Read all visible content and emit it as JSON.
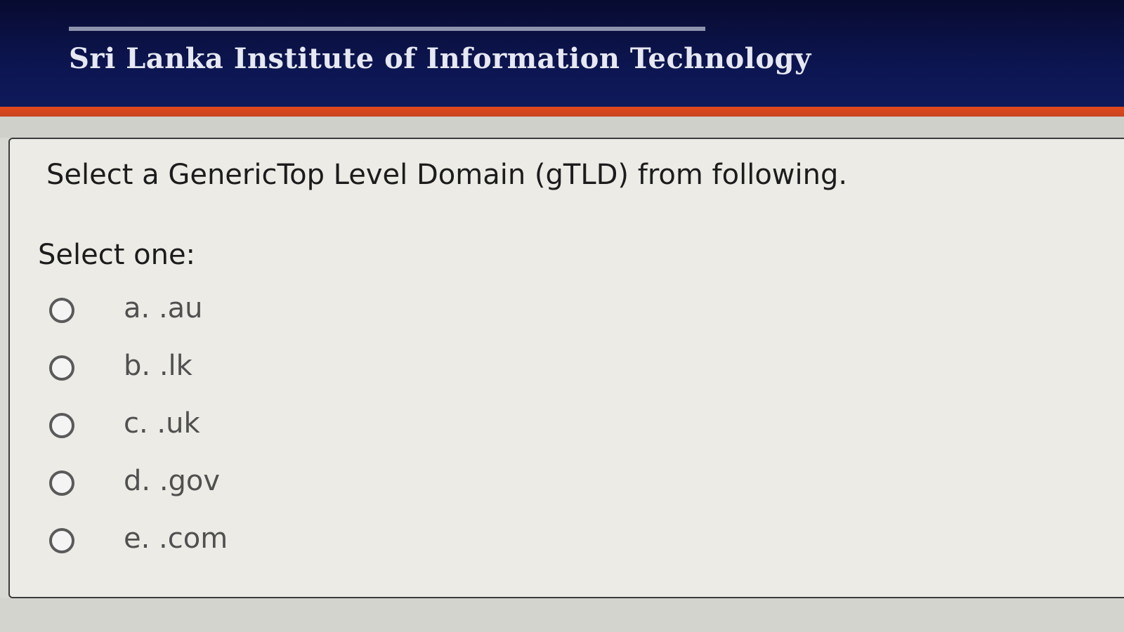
{
  "header": {
    "institution_name": "Sri Lanka Institute of Information Technology"
  },
  "question": {
    "text": "Select a GenericTop Level Domain (gTLD) from following.",
    "prompt": "Select one:",
    "options": [
      {
        "label": "a. .au",
        "selected": false
      },
      {
        "label": "b. .lk",
        "selected": false
      },
      {
        "label": "c. .uk",
        "selected": false
      },
      {
        "label": "d. .gov",
        "selected": false
      },
      {
        "label": "e. .com",
        "selected": false
      }
    ]
  },
  "colors": {
    "header_navy": "#0c1550",
    "accent_orange": "#e2491f",
    "panel_background": "#ecebe6"
  },
  "icons": [
    "radio-unchecked-icon"
  ]
}
